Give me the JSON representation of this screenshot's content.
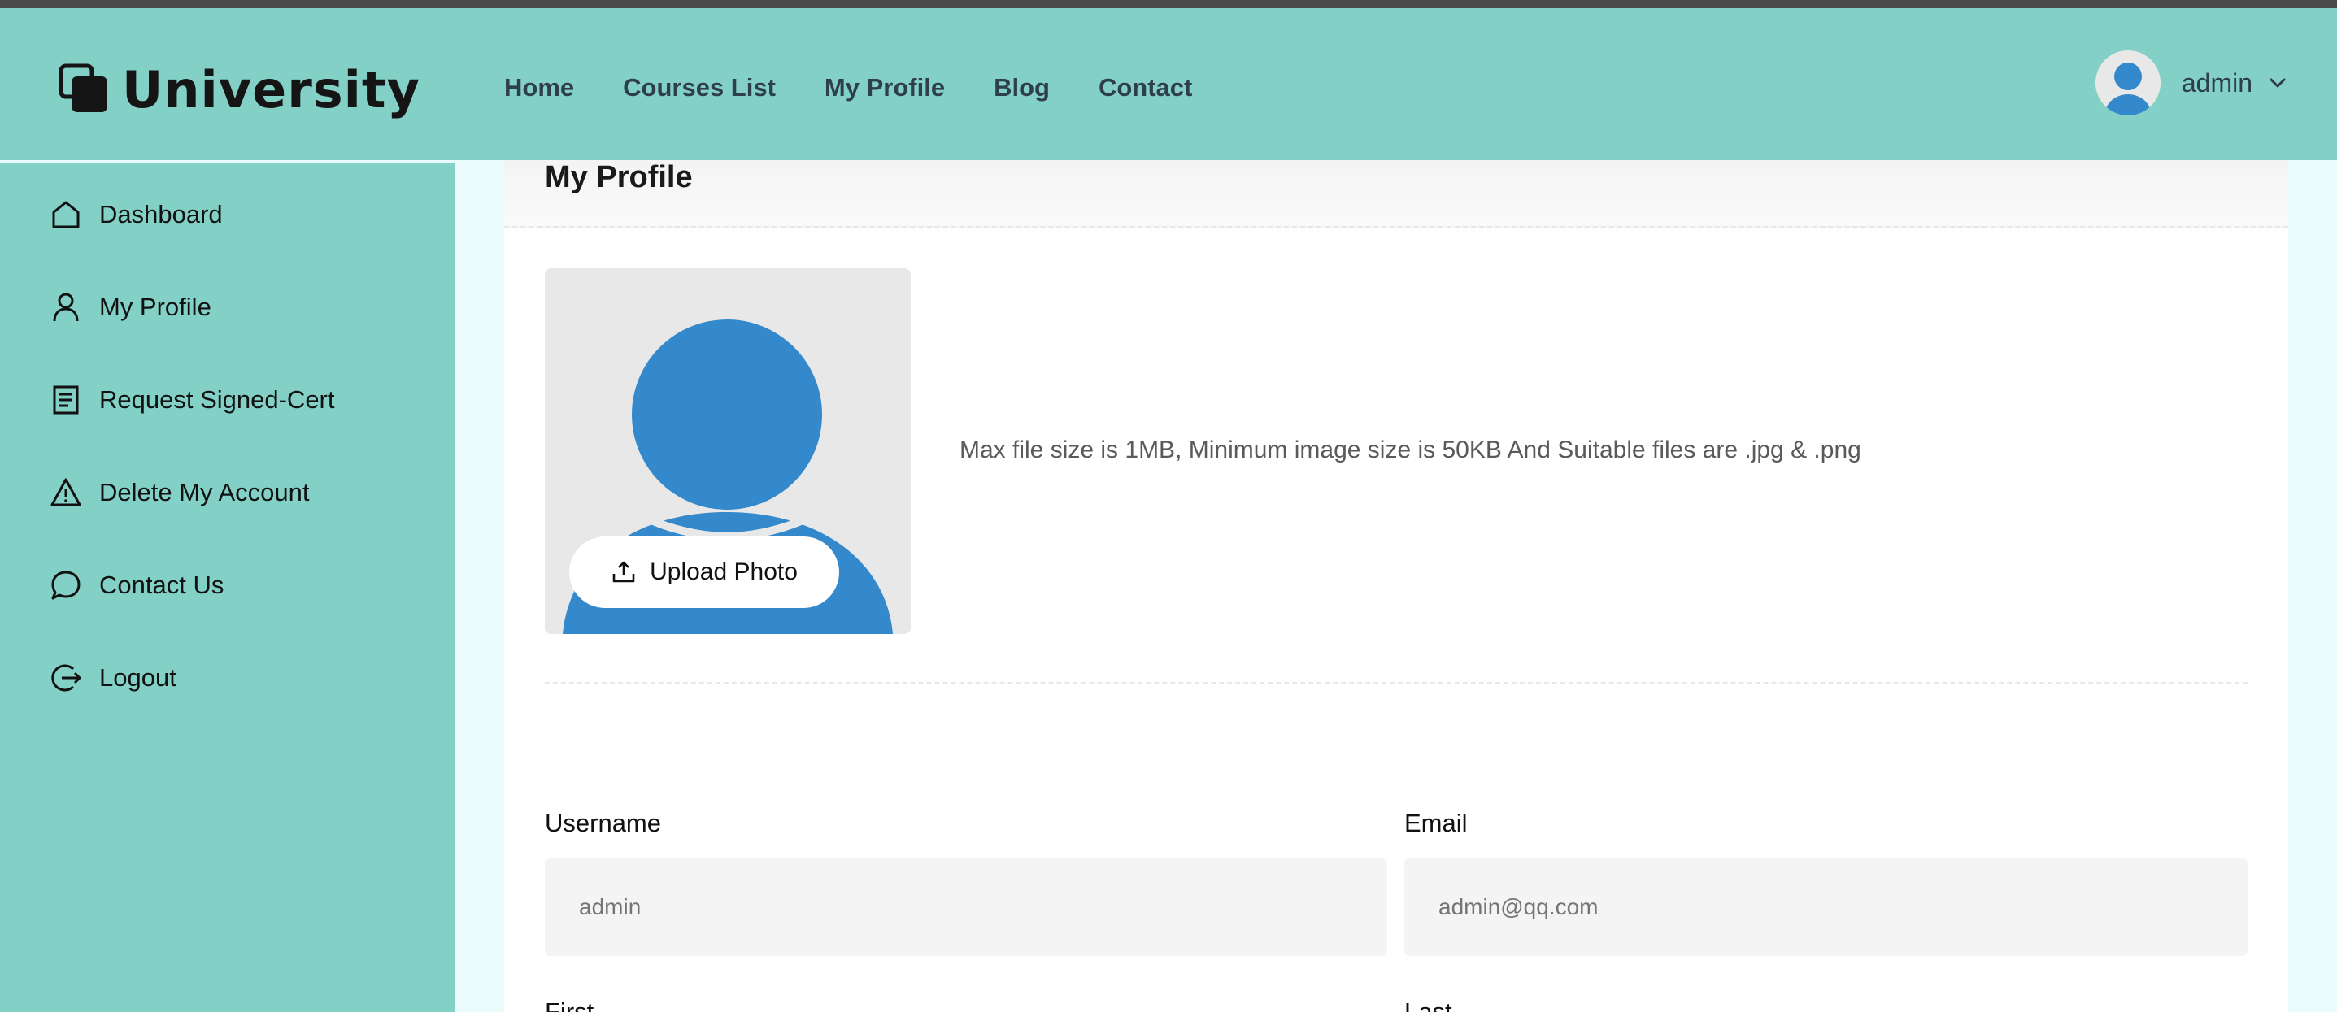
{
  "brand": {
    "name": "University"
  },
  "nav": {
    "items": [
      {
        "label": "Home"
      },
      {
        "label": "Courses List"
      },
      {
        "label": "My Profile"
      },
      {
        "label": "Blog"
      },
      {
        "label": "Contact"
      }
    ]
  },
  "user": {
    "name": "admin"
  },
  "sidebar": {
    "items": [
      {
        "label": "Dashboard",
        "icon": "home-icon"
      },
      {
        "label": "My Profile",
        "icon": "user-icon"
      },
      {
        "label": "Request Signed-Cert",
        "icon": "document-icon"
      },
      {
        "label": "Delete My Account",
        "icon": "warning-icon"
      },
      {
        "label": "Contact Us",
        "icon": "chat-icon"
      },
      {
        "label": "Logout",
        "icon": "logout-icon"
      }
    ]
  },
  "profile": {
    "title": "My Profile",
    "upload_label": "Upload Photo",
    "file_hint": "Max file size is 1MB, Minimum image size is 50KB And Suitable files are .jpg & .png",
    "username_label": "Username",
    "username_placeholder": "admin",
    "email_label": "Email",
    "email_placeholder": "admin@qq.com",
    "first_label_partial": "First",
    "last_label_partial": "Last"
  },
  "colors": {
    "header_bg": "#82d0c6",
    "sidebar_bg": "#82d0c6",
    "avatar_blue": "#3389cb",
    "page_bg": "#e9fbfb"
  }
}
